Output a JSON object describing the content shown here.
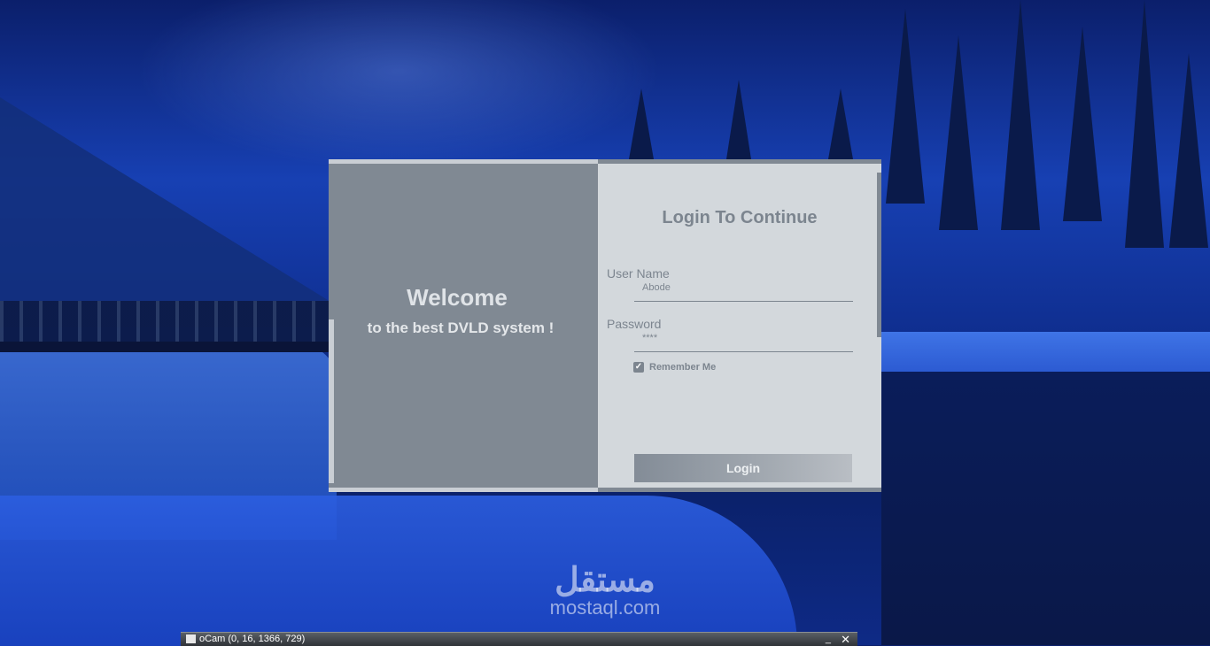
{
  "dialog": {
    "welcome_title": "Welcome",
    "welcome_subtitle": "to the best DVLD system !",
    "form_title": "Login To Continue",
    "username_label": "User Name",
    "username_value": "Abode",
    "password_label": "Password",
    "password_value": "****",
    "remember_label": "Remember Me",
    "remember_checked": true,
    "login_label": "Login"
  },
  "watermark": {
    "arabic": "مستقل",
    "latin": "mostaql.com"
  },
  "taskbar": {
    "title": "oCam (0, 16, 1366, 729)",
    "close_glyph": "✕",
    "minimize_glyph": "_"
  },
  "colors": {
    "left_panel": "#808993",
    "right_panel": "#d3d8dc",
    "text_muted": "#7c858f"
  }
}
